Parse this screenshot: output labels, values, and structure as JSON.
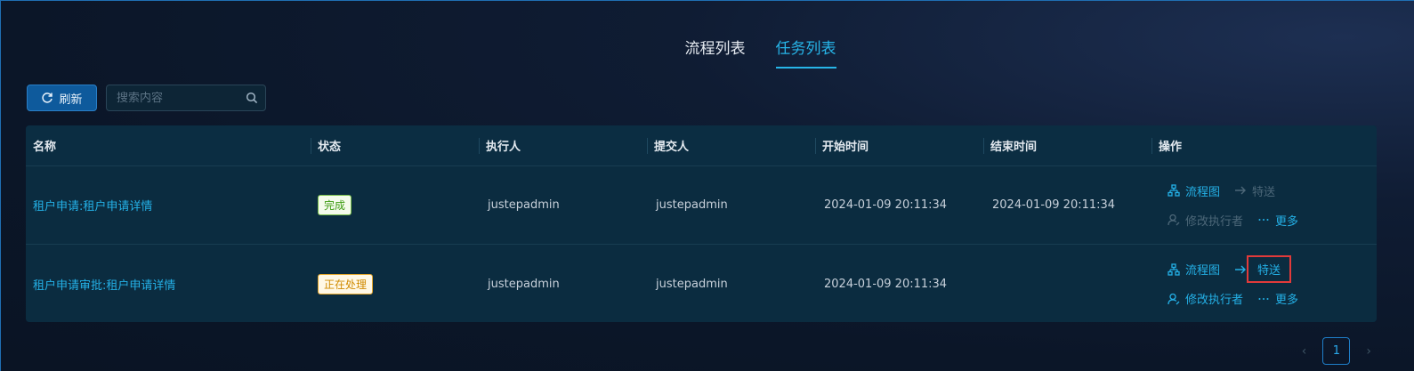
{
  "tabs": [
    {
      "label": "流程列表",
      "active": false
    },
    {
      "label": "任务列表",
      "active": true
    }
  ],
  "toolbar": {
    "refresh_label": "刷新",
    "search_placeholder": "搜索内容"
  },
  "table": {
    "headers": [
      "名称",
      "状态",
      "执行人",
      "提交人",
      "开始时间",
      "结束时间",
      "操作"
    ],
    "rows": [
      {
        "name": "租户申请:租户申请详情",
        "status": "完成",
        "executor": "justepadmin",
        "submitter": "justepadmin",
        "start": "2024-01-09 20:11:34",
        "end": "2024-01-09 20:11:34",
        "ops": {
          "flowchart": "流程图",
          "forward": "特送",
          "modify": "修改执行者",
          "more": "更多"
        }
      },
      {
        "name": "租户申请审批:租户申请详情",
        "status": "正在处理",
        "executor": "justepadmin",
        "submitter": "justepadmin",
        "start": "2024-01-09 20:11:34",
        "end": "",
        "ops": {
          "flowchart": "流程图",
          "forward": "特送",
          "modify": "修改执行者",
          "more": "更多"
        }
      }
    ]
  },
  "pagination": {
    "current": "1"
  },
  "colors": {
    "accent": "#24b0e6",
    "done": "#3d9c12",
    "processing": "#d08a00",
    "highlight": "#e23a3a"
  }
}
